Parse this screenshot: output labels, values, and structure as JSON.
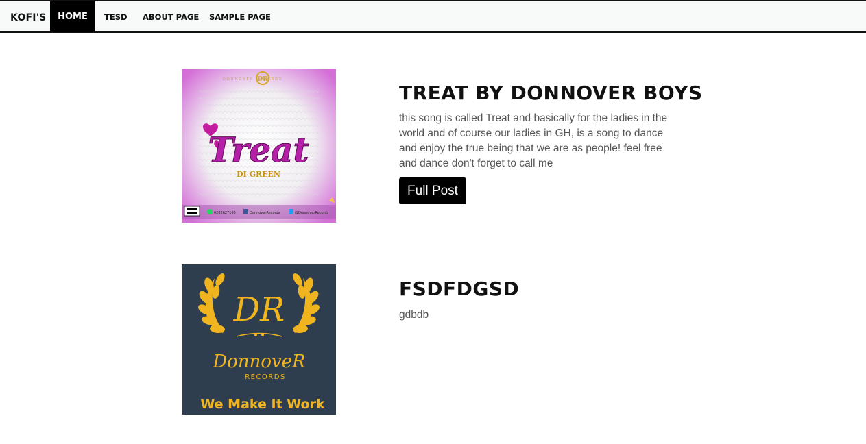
{
  "nav": {
    "brand": "KOFI'S",
    "items": [
      {
        "label": "HOME",
        "active": true
      },
      {
        "label": "TESD",
        "active": false
      },
      {
        "label": "ABOUT PAGE",
        "active": false
      },
      {
        "label": "SAMPLE PAGE",
        "active": false
      }
    ]
  },
  "posts": [
    {
      "title": "TREAT BY DONNOVER BOYS",
      "excerpt": "this song is called Treat and basically for the ladies in the world and of course our ladies in GH, is a song to dance and enjoy the true being that we are as people! feel free and dance don't forget to call me",
      "button_label": "Full Post",
      "image": {
        "title_text": "Treat",
        "subtitle_text": "DI GREEN",
        "header_text": "DONNOVER RECORDS",
        "footer_phone": "0282627195",
        "footer_fb": "DonnoverRecords",
        "footer_tw": "@DonnoverRecords",
        "colors": {
          "frame": "#d98ee0",
          "title": "#b620a8",
          "subtitle": "#c8920a"
        }
      }
    },
    {
      "title": "FSDFDGSD",
      "excerpt": "gdbdb",
      "image": {
        "monogram": "DR",
        "brand_text": "DonnoveR",
        "records_text": "RECORDS",
        "slogan": "We Make It Work",
        "colors": {
          "background": "#2f3e4f",
          "gold": "#f0b51e"
        }
      }
    }
  ]
}
